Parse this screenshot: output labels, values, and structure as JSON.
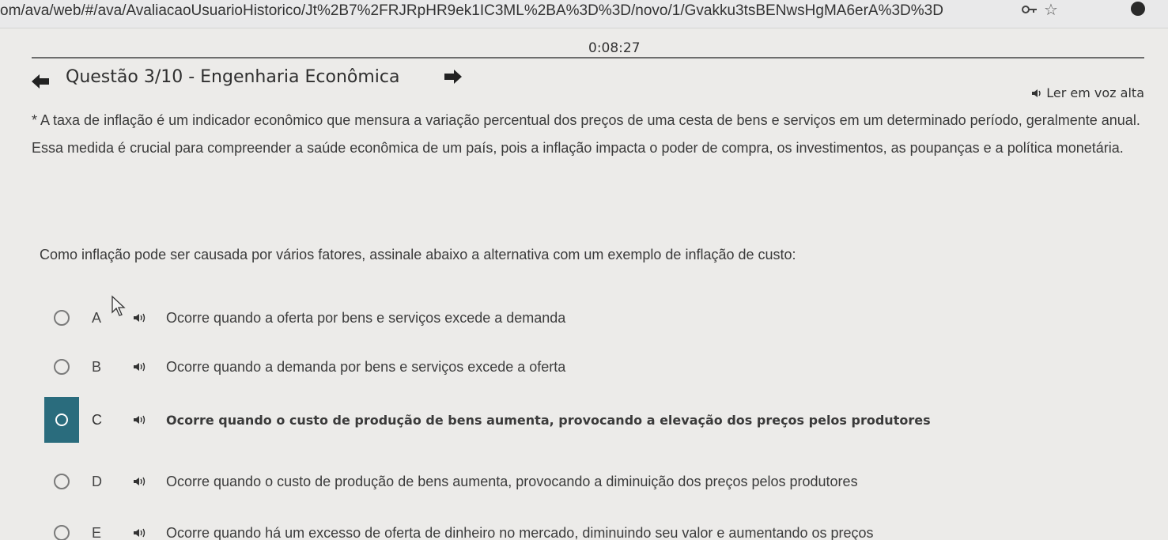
{
  "browser": {
    "url": "om/ava/web/#/ava/AvaliacaoUsuarioHistorico/Jt%2B7%2FRJRpHR9ek1IC3ML%2BA%3D%3D/novo/1/Gvakku3tsBENwsHgMA6erA%3D%3D",
    "icons": [
      "key-icon",
      "star-icon",
      "profile-icon"
    ]
  },
  "timer": "0:08:27",
  "question": {
    "title": "Questão 3/10 - Engenharia Econômica",
    "read_aloud_label": "Ler em voz alta",
    "statement": "* A taxa de inflação é um indicador econômico que mensura a variação percentual dos preços de uma cesta de bens e serviços em um determinado período, geralmente anual. Essa medida é crucial para compreender a saúde econômica de um país, pois a inflação impacta o poder de compra, os investimentos, as poupanças e a política monetária.",
    "prompt": "Como inflação pode ser causada por vários fatores, assinale abaixo a alternativa com um exemplo de inflação de custo:"
  },
  "options": [
    {
      "letter": "A",
      "text": "Ocorre quando a oferta por bens e serviços excede a demanda",
      "selected": false
    },
    {
      "letter": "B",
      "text": "Ocorre quando a demanda por bens e serviços excede a oferta",
      "selected": false
    },
    {
      "letter": "C",
      "text": "Ocorre quando o custo de produção de bens aumenta, provocando a elevação dos preços pelos produtores",
      "selected": true
    },
    {
      "letter": "D",
      "text": "Ocorre quando o custo de produção de bens aumenta, provocando a diminuição dos preços pelos produtores",
      "selected": false
    },
    {
      "letter": "E",
      "text": "Ocorre quando há um excesso de oferta de dinheiro no mercado, diminuindo seu valor e aumentando os preços",
      "selected": false
    }
  ],
  "colors": {
    "selected_accent": "#2a6c7d",
    "background": "#ecebe9"
  }
}
